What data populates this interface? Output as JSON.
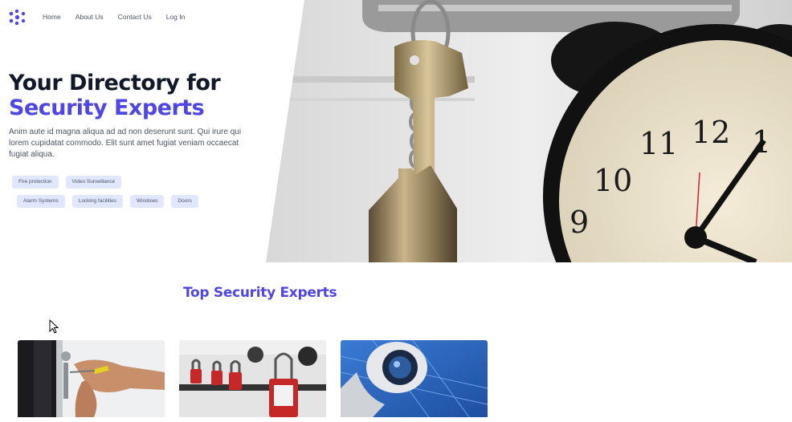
{
  "nav": {
    "logo_icon": "dots-x-logo-icon",
    "items": [
      "Home",
      "About Us",
      "Contact Us",
      "Log In"
    ]
  },
  "hero": {
    "title_line1": "Your Directory for",
    "title_line2": "Security Experts",
    "description": "Anim aute id magna aliqua ad ad non deserunt sunt. Qui irure qui lorem cupidatat commodo. Elit sunt amet fugiat veniam occaecat fugiat aliqua.",
    "tags_row1": [
      "Fire protection",
      "Video Surveillance"
    ],
    "tags_row2": [
      "Alarm Systems",
      "Locking facilities",
      "Windows",
      "Doors"
    ],
    "image": "keys-and-alarm-clock-photo"
  },
  "section": {
    "title": "Top Security Experts",
    "cards": [
      {
        "image": "locksmith-door-lock-photo"
      },
      {
        "image": "safety-padlocks-photo"
      },
      {
        "image": "cctv-camera-photo"
      }
    ]
  },
  "colors": {
    "accent": "#4f46e5",
    "tag_bg": "#e0e7ff",
    "text_dark": "#111827",
    "text_muted": "#4b5563"
  }
}
